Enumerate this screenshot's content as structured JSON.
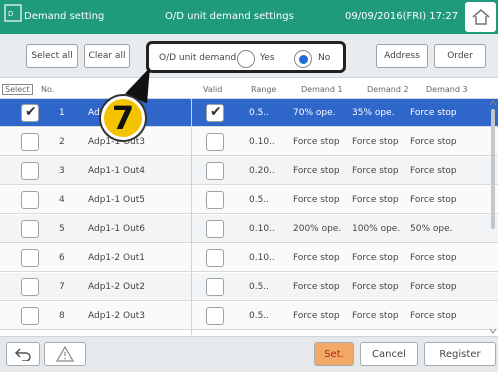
{
  "header": {
    "app_title": "Demand setting",
    "screen_title": "O/D unit demand settings",
    "datetime": "09/09/2016(FRI) 17:27"
  },
  "toolbar": {
    "select_all": "Select all",
    "clear_all": "Clear all",
    "demand_label": "O/D unit demand",
    "yes_label": "Yes",
    "no_label": "No",
    "selected_option": "No",
    "address": "Address",
    "order": "Order"
  },
  "badge": {
    "number": "7"
  },
  "columns": {
    "select": "Select",
    "no": "No.",
    "valid": "Valid",
    "range": "Range",
    "demand1": "Demand 1",
    "demand2": "Demand 2",
    "demand3": "Demand 3"
  },
  "rows": [
    {
      "no": "1",
      "name": "Ad",
      "valid": true,
      "range": "0.5..",
      "d1": "70% ope.",
      "d2": "35% ope.",
      "d3": "Force stop",
      "selected": true
    },
    {
      "no": "2",
      "name": "Adp1-1 Out3",
      "valid": false,
      "range": "0.10..",
      "d1": "Force stop",
      "d2": "Force stop",
      "d3": "Force stop",
      "selected": false
    },
    {
      "no": "3",
      "name": "Adp1-1 Out4",
      "valid": false,
      "range": "0.20..",
      "d1": "Force stop",
      "d2": "Force stop",
      "d3": "Force stop",
      "selected": false
    },
    {
      "no": "4",
      "name": "Adp1-1 Out5",
      "valid": false,
      "range": "0.5..",
      "d1": "Force stop",
      "d2": "Force stop",
      "d3": "Force stop",
      "selected": false
    },
    {
      "no": "5",
      "name": "Adp1-1 Out6",
      "valid": false,
      "range": "0.10..",
      "d1": "200% ope.",
      "d2": "100% ope.",
      "d3": "50% ope.",
      "selected": false
    },
    {
      "no": "6",
      "name": "Adp1-2 Out1",
      "valid": false,
      "range": "0.10..",
      "d1": "Force stop",
      "d2": "Force stop",
      "d3": "Force stop",
      "selected": false
    },
    {
      "no": "7",
      "name": "Adp1-2 Out2",
      "valid": false,
      "range": "0.5..",
      "d1": "Force stop",
      "d2": "Force stop",
      "d3": "Force stop",
      "selected": false
    },
    {
      "no": "8",
      "name": "Adp1-2 Out3",
      "valid": false,
      "range": "0.5..",
      "d1": "Force stop",
      "d2": "Force stop",
      "d3": "Force stop",
      "selected": false
    }
  ],
  "footer": {
    "set": "Set.",
    "cancel": "Cancel",
    "register": "Register"
  },
  "colors": {
    "header": "#1f9a7a",
    "selected_row": "#2e66c9",
    "set_button": "#f2a968",
    "badge": "#f4c400"
  }
}
